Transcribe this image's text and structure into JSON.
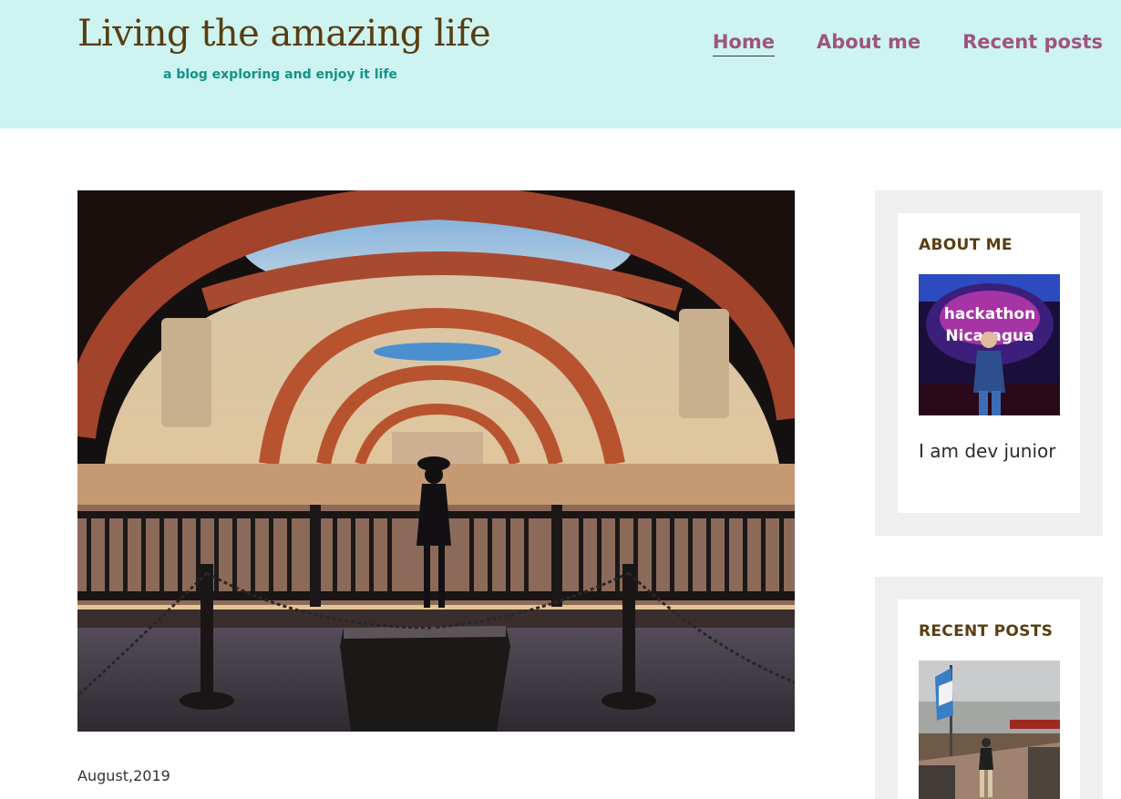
{
  "header": {
    "title": "Living the amazing life",
    "tagline": "a blog exploring and enjoy it life",
    "nav": [
      {
        "label": "Home",
        "active": true
      },
      {
        "label": "About me",
        "active": false
      },
      {
        "label": "Recent posts",
        "active": false
      }
    ]
  },
  "post": {
    "image_icon": "ruins-arches-photo",
    "date": "August,2019"
  },
  "sidebar": {
    "about": {
      "title": "ABOUT ME",
      "photo_text": "<hackathon/> Nicaragua",
      "text": "I am dev junior"
    },
    "recent": {
      "title": "RECENT POSTS"
    }
  },
  "colors": {
    "header_bg": "#cdf4f1",
    "title": "#5a3d12",
    "tagline": "#14928a",
    "nav": "#a0547f",
    "widget_bg": "#efefef"
  }
}
